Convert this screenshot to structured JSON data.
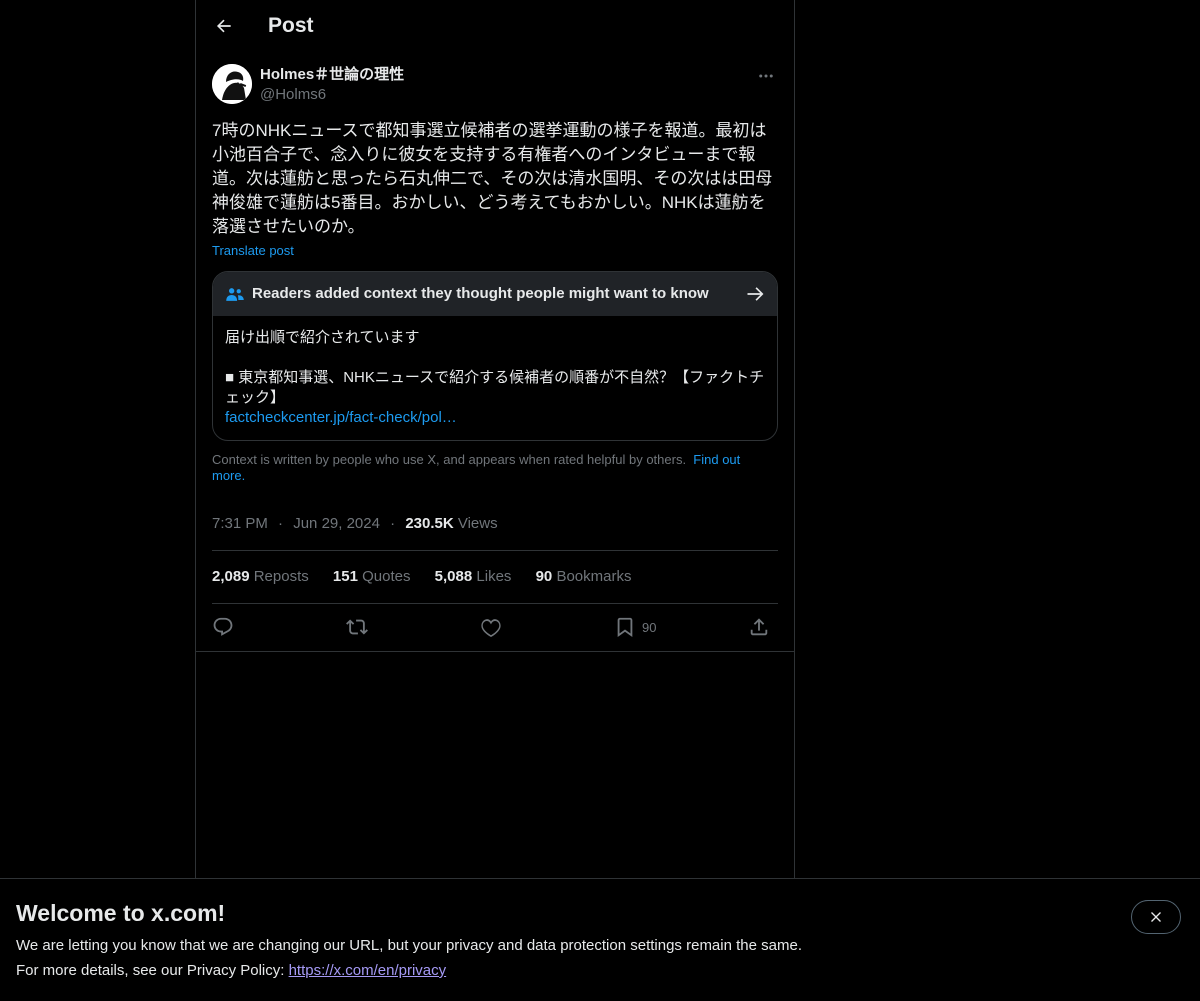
{
  "header": {
    "title": "Post"
  },
  "author": {
    "display_name": "Holmes＃世論の理性",
    "handle": "@Holms6"
  },
  "post": {
    "text": "7時のNHKニュースで都知事選立候補者の選挙運動の様子を報道。最初は小池百合子で、念入りに彼女を支持する有権者へのインタビューまで報道。次は蓮舫と思ったら石丸伸二で、その次は清水国明、その次はは田母神俊雄で蓮舫は5番目。おかしい、どう考えてもおかしい。NHKは蓮舫を落選させたいのか。",
    "translate_label": "Translate post"
  },
  "community_note": {
    "header": "Readers added context they thought people might want to know",
    "body": "届け出順で紹介されています",
    "source_title": "■ 東京都知事選、NHKニュースで紹介する候補者の順番が不自然？【ファクトチェック】",
    "source_link": "factcheckcenter.jp/fact-check/pol…",
    "footer": "Context is written by people who use X, and appears when rated helpful by others.",
    "find_out": "Find out more."
  },
  "meta": {
    "time": "7:31 PM",
    "date": "Jun 29, 2024",
    "views_count": "230.5K",
    "views_label": "Views",
    "separator": "·"
  },
  "stats": {
    "reposts_count": "2,089",
    "reposts_label": "Reposts",
    "quotes_count": "151",
    "quotes_label": "Quotes",
    "likes_count": "5,088",
    "likes_label": "Likes",
    "bookmarks_count": "90",
    "bookmarks_label": "Bookmarks"
  },
  "actions": {
    "reply_icon": "reply-icon",
    "repost_icon": "repost-icon",
    "like_icon": "heart-icon",
    "bookmark_icon": "bookmark-icon",
    "bookmark_count": "90",
    "share_icon": "share-icon"
  },
  "banner": {
    "title": "Welcome to x.com!",
    "line1": "We are letting you know that we are changing our URL, but your privacy and data protection settings remain the same.",
    "line2_prefix": "For more details, see our Privacy Policy: ",
    "line2_link": "https://x.com/en/privacy"
  },
  "colors": {
    "background": "#000000",
    "text": "#e7e9ea",
    "muted": "#71767b",
    "accent": "#1d9bf0",
    "border": "#2f3336",
    "banner_link": "#a59af5"
  }
}
